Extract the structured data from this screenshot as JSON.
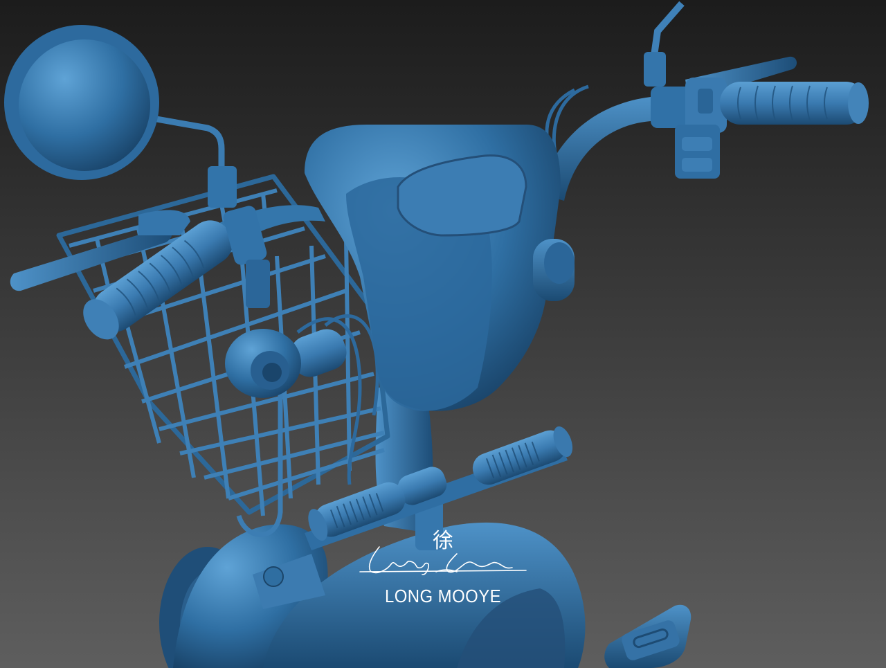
{
  "watermark": {
    "character": "徐",
    "name": "LONG MOOYE"
  },
  "colors": {
    "background_top": "#1d1d1d",
    "background_bottom": "#5c5c5c",
    "model_light": "#4a8fc4",
    "model_mid": "#2f6fa3",
    "model_dark": "#1e4f7a",
    "model_shadow": "#143858",
    "watermark": "#ffffff"
  }
}
